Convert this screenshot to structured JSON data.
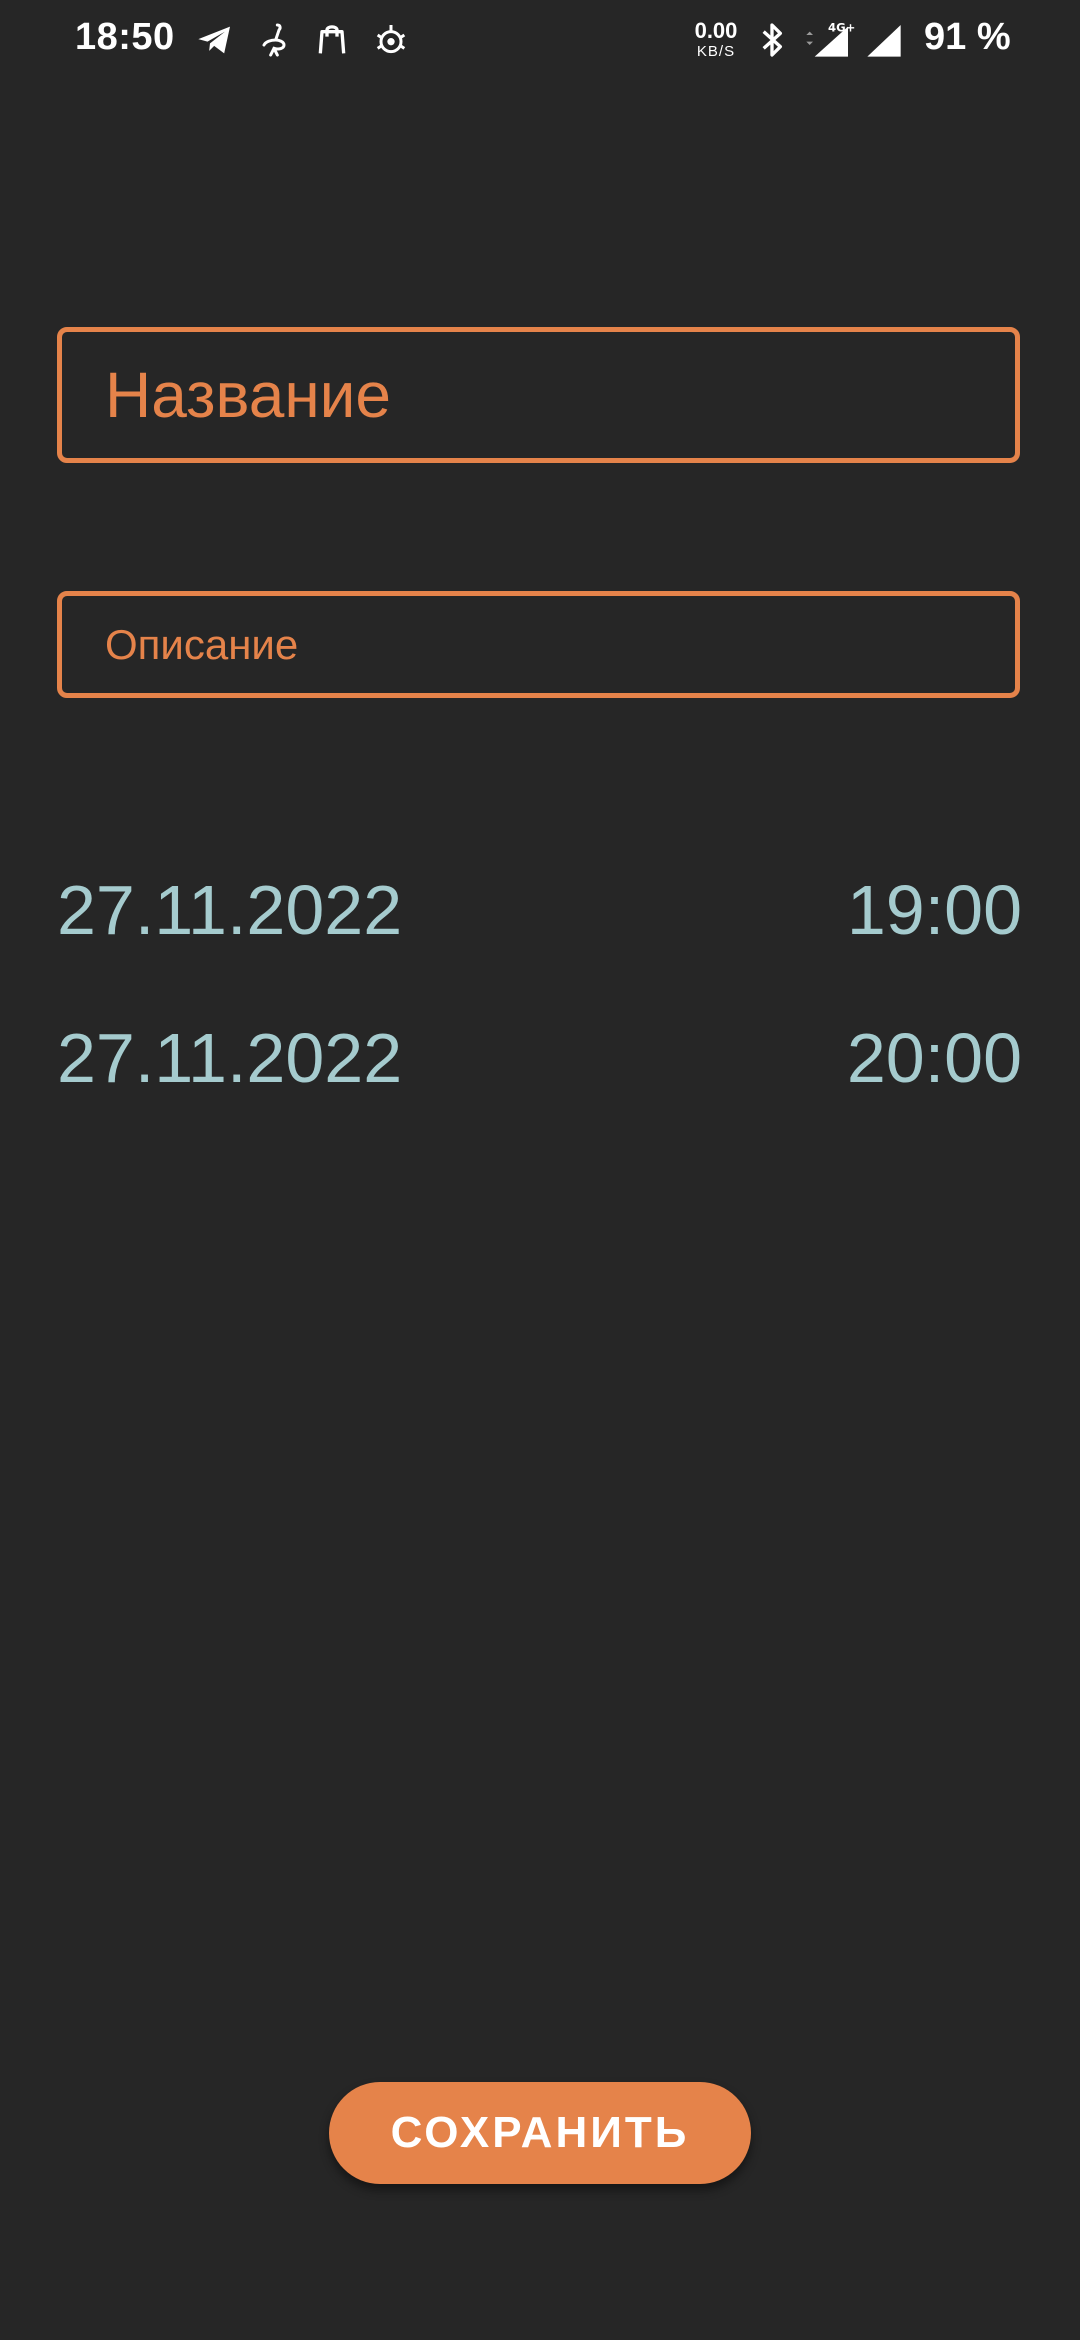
{
  "status_bar": {
    "time": "18:50",
    "net_speed_value": "0.00",
    "net_speed_unit": "KB/S",
    "network_type": "4G+",
    "battery": "91 %",
    "icons": [
      "telegram-icon",
      "ostrich-icon",
      "shopping-bag-icon",
      "gear-bug-icon",
      "bluetooth-icon",
      "signal-4g-icon",
      "signal-icon"
    ]
  },
  "form": {
    "title_placeholder": "Название",
    "description_placeholder": "Описание"
  },
  "schedule": {
    "start": {
      "date": "27.11.2022",
      "time": "19:00"
    },
    "end": {
      "date": "27.11.2022",
      "time": "20:00"
    }
  },
  "actions": {
    "save_label": "СОХРАНИТЬ"
  },
  "colors": {
    "background": "#262626",
    "accent": "#e5834a",
    "datetime_text": "#a5cbce"
  }
}
